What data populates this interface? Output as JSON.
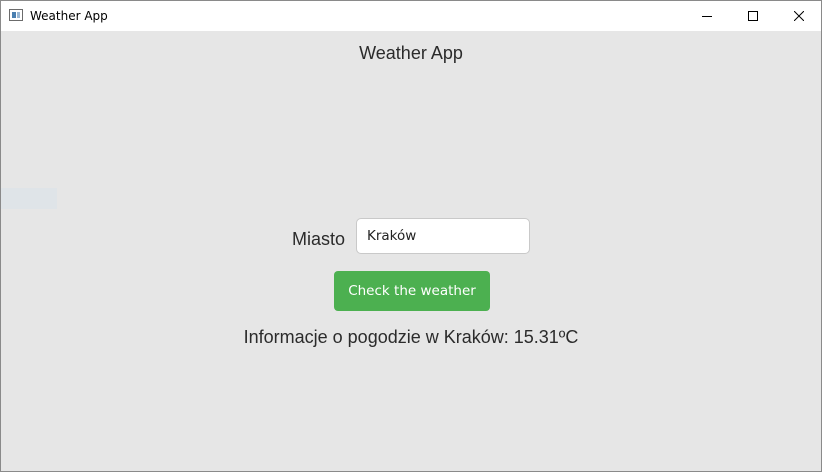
{
  "window": {
    "title": "Weather App",
    "controls": {
      "minimize_icon": "minimize-icon",
      "maximize_icon": "maximize-icon",
      "close_icon": "close-icon"
    }
  },
  "main": {
    "heading": "Weather App",
    "city_label": "Miasto",
    "city_input": {
      "value": "Kraków",
      "placeholder": ""
    },
    "check_button_label": "Check the weather",
    "weather_info": "Informacje o pogodzie w Kraków: 15.31ºC"
  },
  "colors": {
    "background": "#e6e6e6",
    "button": "#4cb050",
    "button_text": "#ffffff",
    "text": "#2b2b2b"
  }
}
